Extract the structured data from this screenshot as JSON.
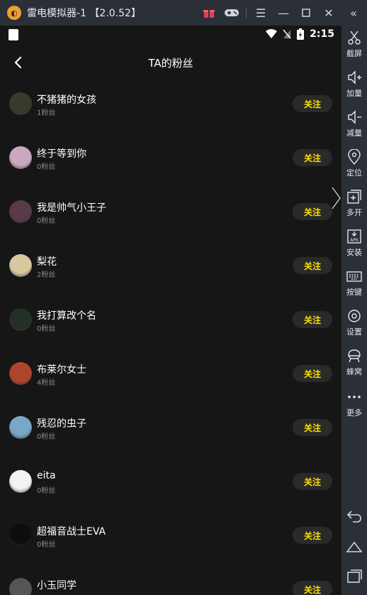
{
  "window": {
    "title": "雷电模拟器-1",
    "version": "【2.0.52】"
  },
  "statusbar": {
    "time": "2:15"
  },
  "header": {
    "title": "TA的粉丝"
  },
  "follow_label": "关注",
  "users": [
    {
      "name": "不猪猪的女孩",
      "fans": "1粉丝",
      "avatar_color": "#3a3a2a"
    },
    {
      "name": "终于等到你",
      "fans": "0粉丝",
      "avatar_color": "#c9a9c0"
    },
    {
      "name": "我是帅气小王子",
      "fans": "0粉丝",
      "avatar_color": "#5a3a4a"
    },
    {
      "name": "梨花",
      "fans": "2粉丝",
      "avatar_color": "#d8c9a0"
    },
    {
      "name": "我打算改个名",
      "fans": "0粉丝",
      "avatar_color": "#223026"
    },
    {
      "name": "布莱尔女士",
      "fans": "4粉丝",
      "avatar_color": "#b0452e"
    },
    {
      "name": "残忍的虫子",
      "fans": "0粉丝",
      "avatar_color": "#7aa6c8"
    },
    {
      "name": "eita",
      "fans": "0粉丝",
      "avatar_color": "#f2f2f2"
    },
    {
      "name": "超福音战士EVA",
      "fans": "0粉丝",
      "avatar_color": "#0d0d0d"
    },
    {
      "name": "小玉同学",
      "fans": "",
      "avatar_color": "#555555"
    }
  ],
  "sidebar": {
    "items": [
      {
        "label": "截屏",
        "icon": "scissors-icon"
      },
      {
        "label": "加量",
        "icon": "volume-up-icon"
      },
      {
        "label": "减量",
        "icon": "volume-down-icon"
      },
      {
        "label": "定位",
        "icon": "location-icon"
      },
      {
        "label": "多开",
        "icon": "multi-instance-icon"
      },
      {
        "label": "安装",
        "icon": "apk-install-icon"
      },
      {
        "label": "按键",
        "icon": "keyboard-icon"
      },
      {
        "label": "设置",
        "icon": "gear-icon"
      },
      {
        "label": "蜂窝",
        "icon": "hive-icon"
      },
      {
        "label": "更多",
        "icon": "more-icon"
      }
    ]
  },
  "colors": {
    "accent": "#ffe200",
    "background": "#161616",
    "chrome": "#2b2f38"
  }
}
